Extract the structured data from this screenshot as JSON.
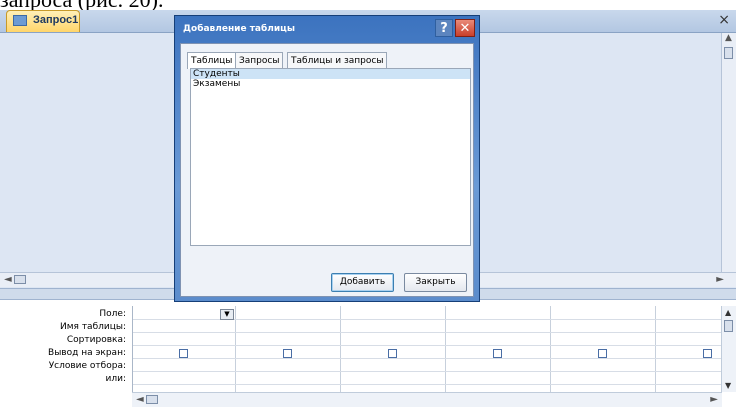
{
  "caption": "запроса (рис. 20).",
  "document_tab": {
    "label": "Запрос1",
    "close": "×"
  },
  "scroll": {
    "left": "◄",
    "right": "►",
    "up": "▲",
    "down": "▼"
  },
  "dialog": {
    "title": "Добавление таблицы",
    "help": "?",
    "close": "✕",
    "tabs": [
      "Таблицы",
      "Запросы",
      "Таблицы и запросы"
    ],
    "active_tab": 0,
    "list_items": [
      "Студенты",
      "Экзамены"
    ],
    "selected_item": 0,
    "add_button": "Добавить",
    "close_button": "Закрыть"
  },
  "grid": {
    "row_labels": [
      "Поле:",
      "Имя таблицы:",
      "Сортировка:",
      "Вывод на экран:",
      "Условие отбора:",
      "или:"
    ],
    "field_dropdown": "▼",
    "column_count": 6
  }
}
